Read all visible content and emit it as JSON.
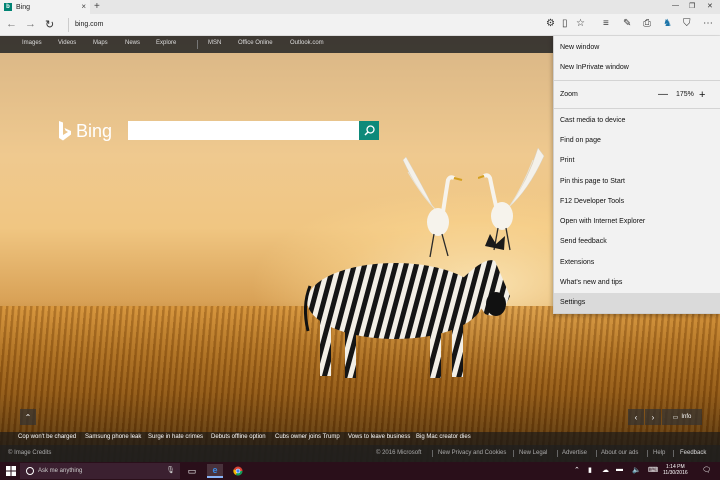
{
  "browser": {
    "tab_title": "Bing",
    "tab_favicon": "b",
    "url": "bing.com",
    "new_tab_label": "+",
    "close_tab_label": "×"
  },
  "bing": {
    "nav_links": [
      "Images",
      "Videos",
      "Maps",
      "News",
      "Explore",
      "MSN",
      "Office Online",
      "Outlook.com"
    ],
    "logo_text": "Bing",
    "search_value": "",
    "search_placeholder": "",
    "news": [
      "Cop won't be charged",
      "Samsung phone leak",
      "Surge in hate crimes",
      "Debuts offline option",
      "Cubs owner joins Trump",
      "Vows to leave business",
      "Big Mac creator dies"
    ],
    "image_credits": "© Image Credits",
    "footer_links": [
      "© 2016 Microsoft",
      "New Privacy and Cookies",
      "New Legal",
      "Advertise",
      "About our ads",
      "Help",
      "Feedback"
    ],
    "info_label": "Info"
  },
  "menu": {
    "items": [
      "New window",
      "New InPrivate window",
      "Zoom",
      "Cast media to device",
      "Find on page",
      "Print",
      "Pin this page to Start",
      "F12 Developer Tools",
      "Open with Internet Explorer",
      "Send feedback",
      "Extensions",
      "What's new and tips",
      "Settings"
    ],
    "zoom_value": "175%",
    "zoom_minus": "—",
    "zoom_plus": "+",
    "selected": "Settings"
  },
  "taskbar": {
    "search_placeholder": "Ask me anything",
    "time": "1:14 PM",
    "date": "11/30/2016"
  },
  "colors": {
    "accent": "#0e8a7a",
    "taskbar": "#2a0f1a",
    "menu_bg": "#f2f2f2"
  }
}
